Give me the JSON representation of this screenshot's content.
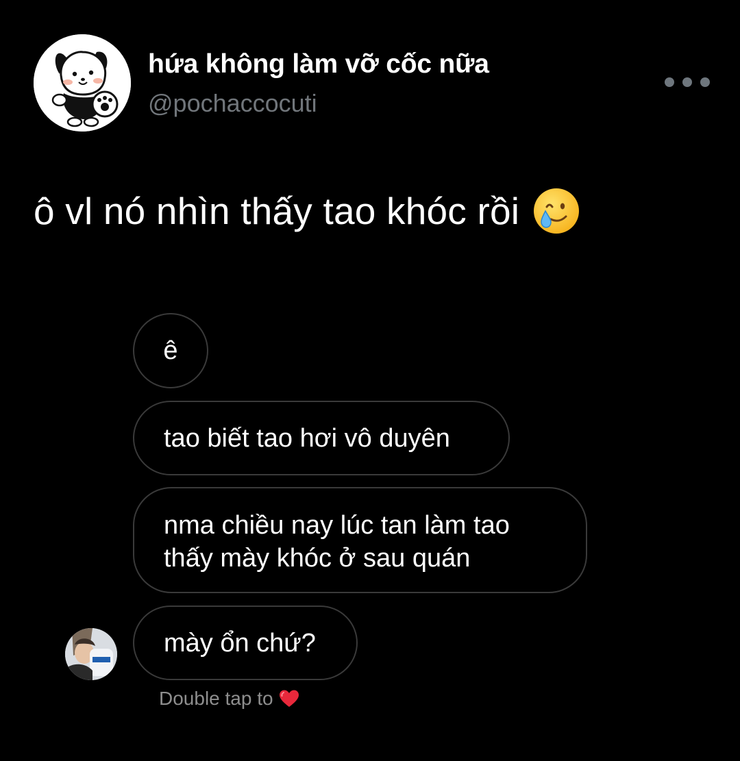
{
  "profile": {
    "display_name": "hứa không làm vỡ cốc nữa",
    "handle": "@pochaccocuti",
    "avatar_icon": "pochacco-dog-avatar"
  },
  "more_icon": "more-horizontal-icon",
  "tweet": {
    "text": "ô vl nó nhìn thấy tao khóc rồi",
    "emoji": "smiling-face-with-tear-emoji"
  },
  "messages": [
    {
      "lines": [
        "ê"
      ]
    },
    {
      "lines": [
        "tao biết tao hơi vô duyên"
      ]
    },
    {
      "lines": [
        "nma chiều nay lúc tan làm tao",
        "thấy mày khóc ở sau quán"
      ]
    },
    {
      "lines": [
        "mày ổn chứ?"
      ]
    }
  ],
  "double_tap": {
    "text": "Double tap to",
    "icon": "red-heart-icon"
  },
  "colors": {
    "background": "#000000",
    "handle": "#71767b",
    "bubble_border": "#3a3a3a",
    "heart": "#e0245e"
  }
}
